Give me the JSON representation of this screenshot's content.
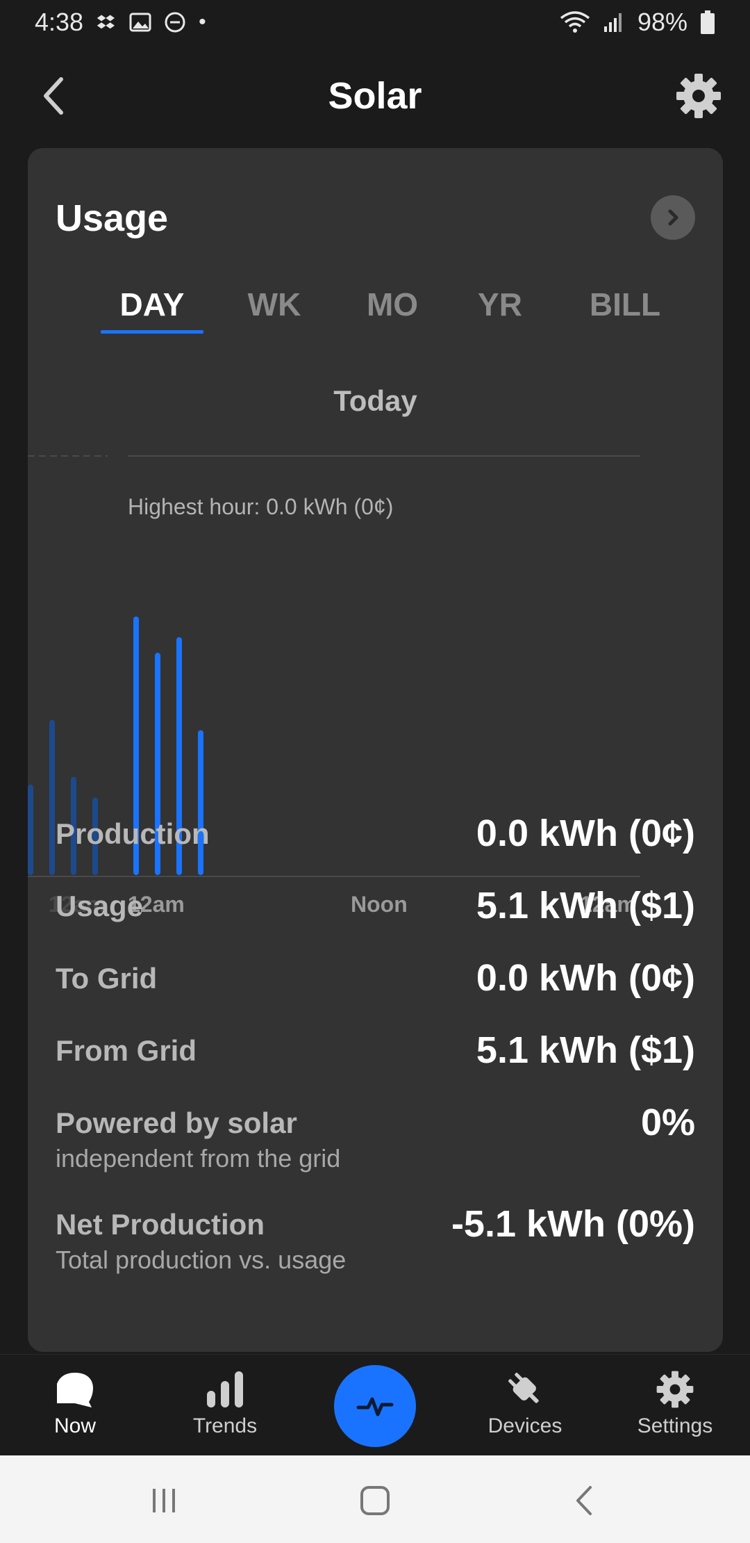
{
  "status_bar": {
    "time": "4:38",
    "battery": "98%",
    "dot": "•"
  },
  "header": {
    "title": "Solar"
  },
  "card": {
    "title": "Usage",
    "tabs": [
      {
        "label": "DAY",
        "active": true
      },
      {
        "label": "WK",
        "active": false
      },
      {
        "label": "MO",
        "active": false
      },
      {
        "label": "YR",
        "active": false
      },
      {
        "label": "BILL",
        "active": false
      }
    ],
    "period_label": "Today",
    "highest_hour": "Highest hour: 0.0 kWh (0¢)",
    "stats": [
      {
        "label": "Production",
        "value": "0.0 kWh (0¢)",
        "sub": ""
      },
      {
        "label": "Usage",
        "value": "5.1 kWh ($1)",
        "sub": ""
      },
      {
        "label": "To Grid",
        "value": "0.0 kWh (0¢)",
        "sub": ""
      },
      {
        "label": "From Grid",
        "value": "5.1 kWh ($1)",
        "sub": ""
      },
      {
        "label": "Powered by solar",
        "value": "0%",
        "sub": "independent from the grid"
      },
      {
        "label": "Net Production",
        "value": "-5.1 kWh (0%)",
        "sub": "Total production vs. usage"
      }
    ]
  },
  "chart_data": {
    "type": "bar",
    "x_tick_labels": [
      "12am",
      "12am",
      "Noon",
      "12am"
    ],
    "previous_day_values": [
      0.35,
      0.6,
      0.38,
      0.3
    ],
    "today_values": [
      1.0,
      0.86,
      0.92,
      0.56
    ],
    "colors": {
      "today": "#1a73ff",
      "previous": "#1d4a8c"
    }
  },
  "bottom_nav": {
    "items": [
      {
        "label": "Now",
        "icon": "chat-bubble-icon",
        "active": true
      },
      {
        "label": "Trends",
        "icon": "bar-chart-icon",
        "active": false
      },
      {
        "label": "Devices",
        "icon": "plug-icon",
        "active": false
      },
      {
        "label": "Settings",
        "icon": "gear-icon",
        "active": false
      }
    ]
  },
  "colors": {
    "accent": "#1a73ff",
    "card_bg": "#333333",
    "page_bg": "#1b1b1b"
  }
}
